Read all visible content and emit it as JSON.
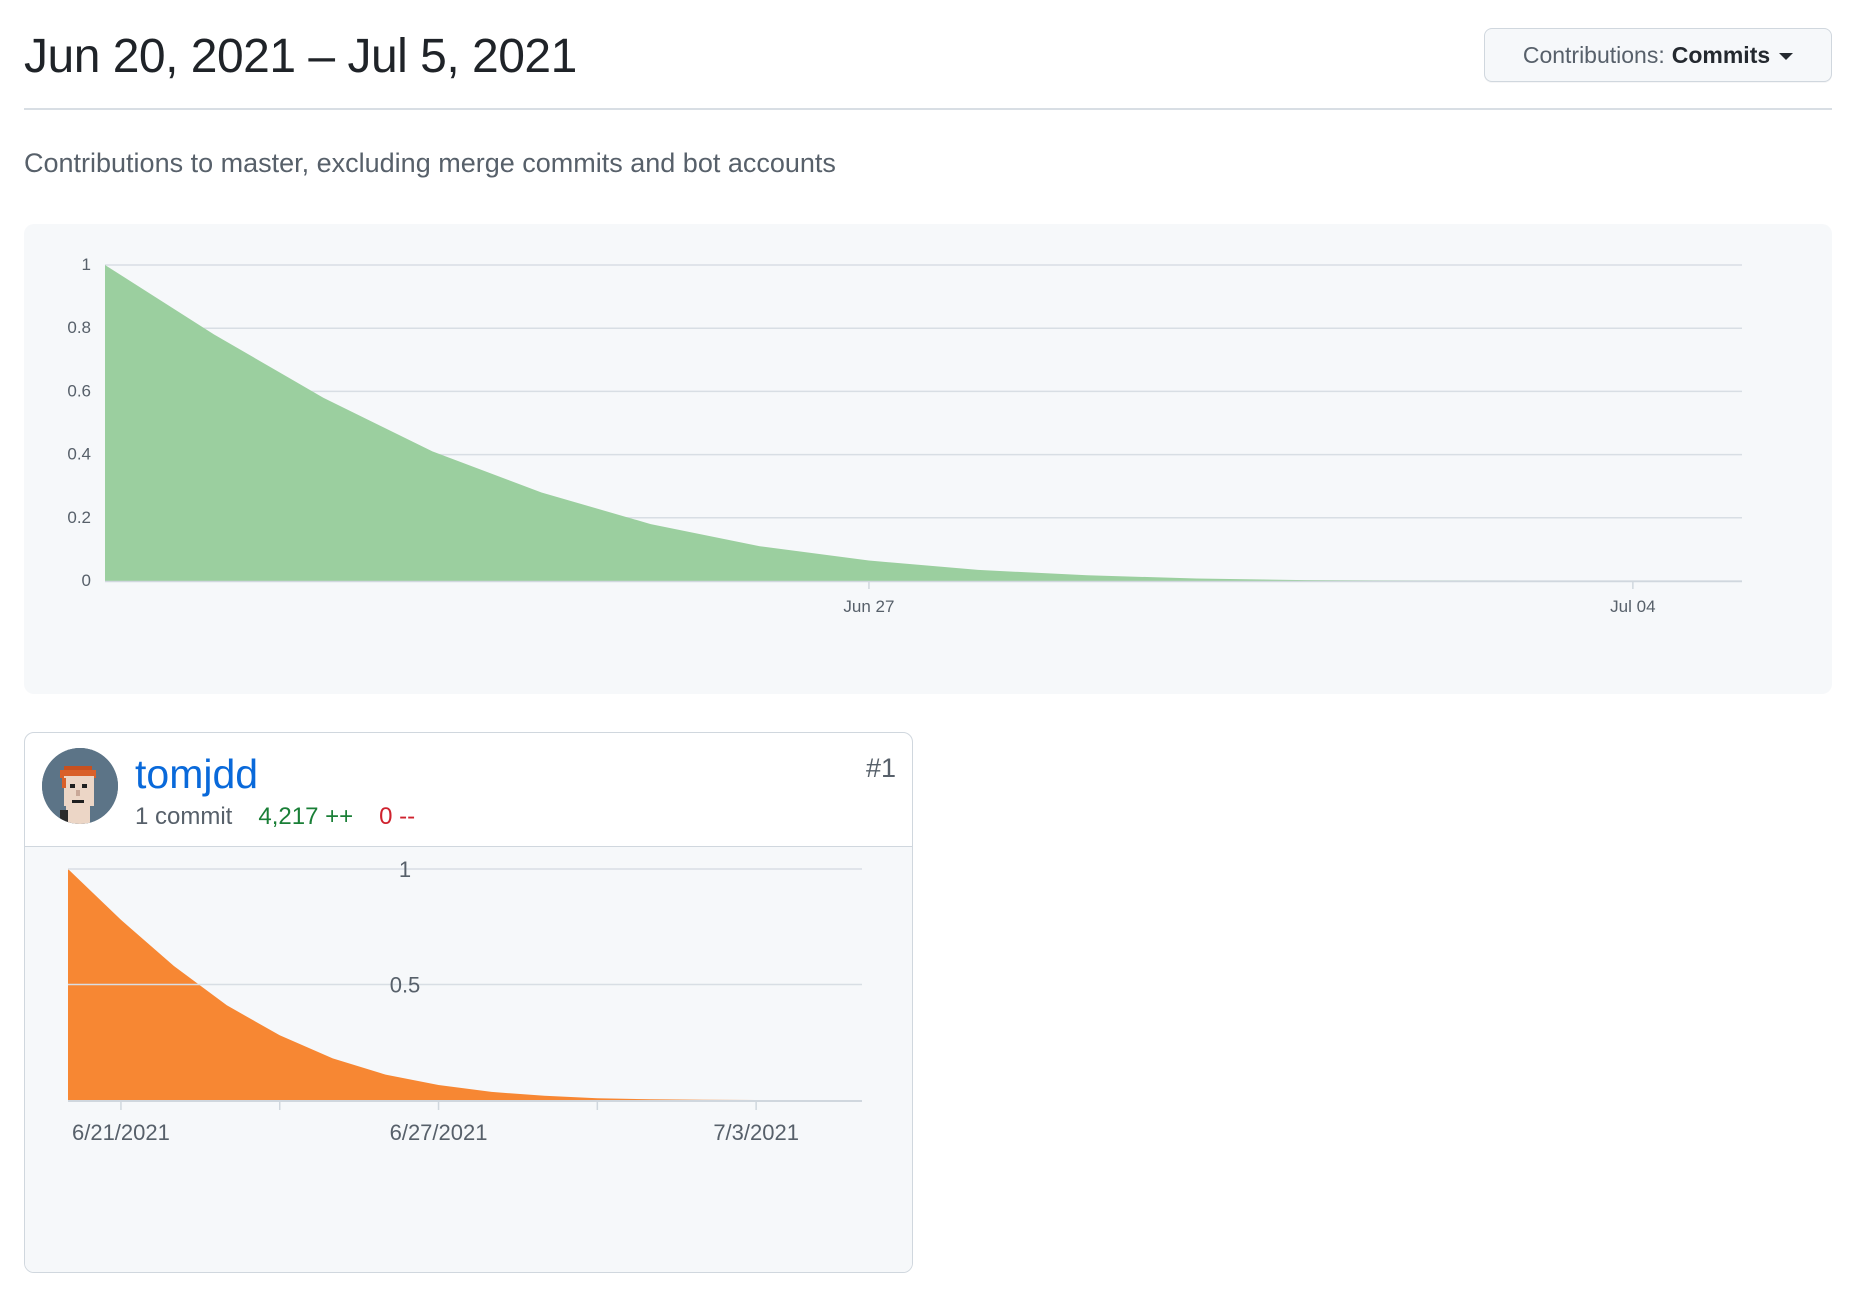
{
  "header": {
    "date_range": "Jun 20, 2021 – Jul 5, 2021",
    "dropdown_prefix": "Contributions:",
    "dropdown_value": "Commits"
  },
  "description": "Contributions to master, excluding merge commits and bot accounts",
  "colors": {
    "main_area": "#9bcf9f",
    "contributor_area": "#f78733",
    "link": "#0969da",
    "additions": "#1a7f37",
    "deletions": "#cf222e"
  },
  "contributor": {
    "username": "tomjdd",
    "rank": "#1",
    "commits": "1 commit",
    "additions": "4,217 ++",
    "deletions": "0 --",
    "avatar_icon": "pixel-avatar-icon"
  },
  "chart_data": [
    {
      "type": "area",
      "x": [
        "2021-06-20",
        "2021-06-21",
        "2021-06-22",
        "2021-06-23",
        "2021-06-24",
        "2021-06-25",
        "2021-06-26",
        "2021-06-27",
        "2021-06-28",
        "2021-06-29",
        "2021-06-30",
        "2021-07-01",
        "2021-07-02",
        "2021-07-03",
        "2021-07-04",
        "2021-07-05"
      ],
      "series": [
        {
          "values": [
            1,
            0.78,
            0.58,
            0.41,
            0.28,
            0.18,
            0.11,
            0.065,
            0.035,
            0.018,
            0.008,
            0.003,
            0.001,
            0,
            0,
            0
          ]
        }
      ],
      "xticks": [
        "Jun 27",
        "Jul 04"
      ],
      "yticks": [
        "0",
        "0.2",
        "0.4",
        "0.6",
        "0.8",
        "1"
      ],
      "ylim": [
        0,
        1
      ],
      "grid": true
    },
    {
      "type": "area",
      "x": [
        "2021-06-20",
        "2021-06-21",
        "2021-06-22",
        "2021-06-23",
        "2021-06-24",
        "2021-06-25",
        "2021-06-26",
        "2021-06-27",
        "2021-06-28",
        "2021-06-29",
        "2021-06-30",
        "2021-07-01",
        "2021-07-02",
        "2021-07-03",
        "2021-07-04",
        "2021-07-05"
      ],
      "series": [
        {
          "values": [
            1,
            0.78,
            0.58,
            0.41,
            0.28,
            0.18,
            0.11,
            0.065,
            0.035,
            0.018,
            0.008,
            0.003,
            0.001,
            0,
            0,
            0
          ]
        }
      ],
      "xticks": [
        "6/21/2021",
        "6/27/2021",
        "7/3/2021"
      ],
      "yticks": [
        "0.5",
        "1"
      ],
      "ylim": [
        0,
        1
      ],
      "grid": true
    }
  ]
}
